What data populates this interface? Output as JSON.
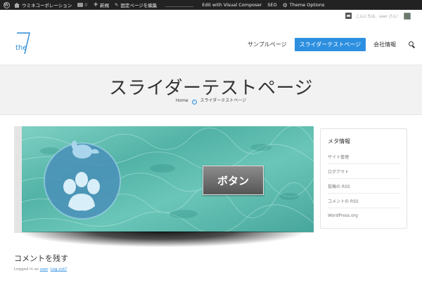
{
  "admin_bar": {
    "site_name": "ウミネコーポレーション",
    "comments_count": "0",
    "new_label": "新規",
    "edit_label": "固定ページを編集",
    "visual_composer_label": "Edit with Visual Composer",
    "seo_label": "SEO",
    "theme_options_label": "Theme Options"
  },
  "util_bar": {
    "greeting": "こんにちは、user さん！"
  },
  "header": {
    "logo_text": "the",
    "nav": [
      {
        "label": "サンプルページ",
        "active": false
      },
      {
        "label": "スライダーテストページ",
        "active": true
      },
      {
        "label": "会社情報",
        "active": false
      }
    ]
  },
  "banner": {
    "title": "スライダーテストページ",
    "breadcrumb": {
      "home": "Home",
      "current": "スライダーテストページ"
    }
  },
  "slider": {
    "button_label": "ボタン"
  },
  "sidebar": {
    "title": "メタ情報",
    "items": [
      {
        "label": "サイト管理"
      },
      {
        "label": "ログアウト"
      },
      {
        "label": "投稿の RSS"
      },
      {
        "label": "コメントの RSS"
      },
      {
        "label": "WordPress.org"
      }
    ]
  },
  "comments": {
    "title": "コメントを残す",
    "logged_in_prefix": "Logged in as",
    "user_link": "user",
    "logout_link": "Log out?"
  },
  "colors": {
    "admin_bar": "#222222",
    "accent": "#2d8fe0",
    "slider_teal": "#52b3a6"
  }
}
